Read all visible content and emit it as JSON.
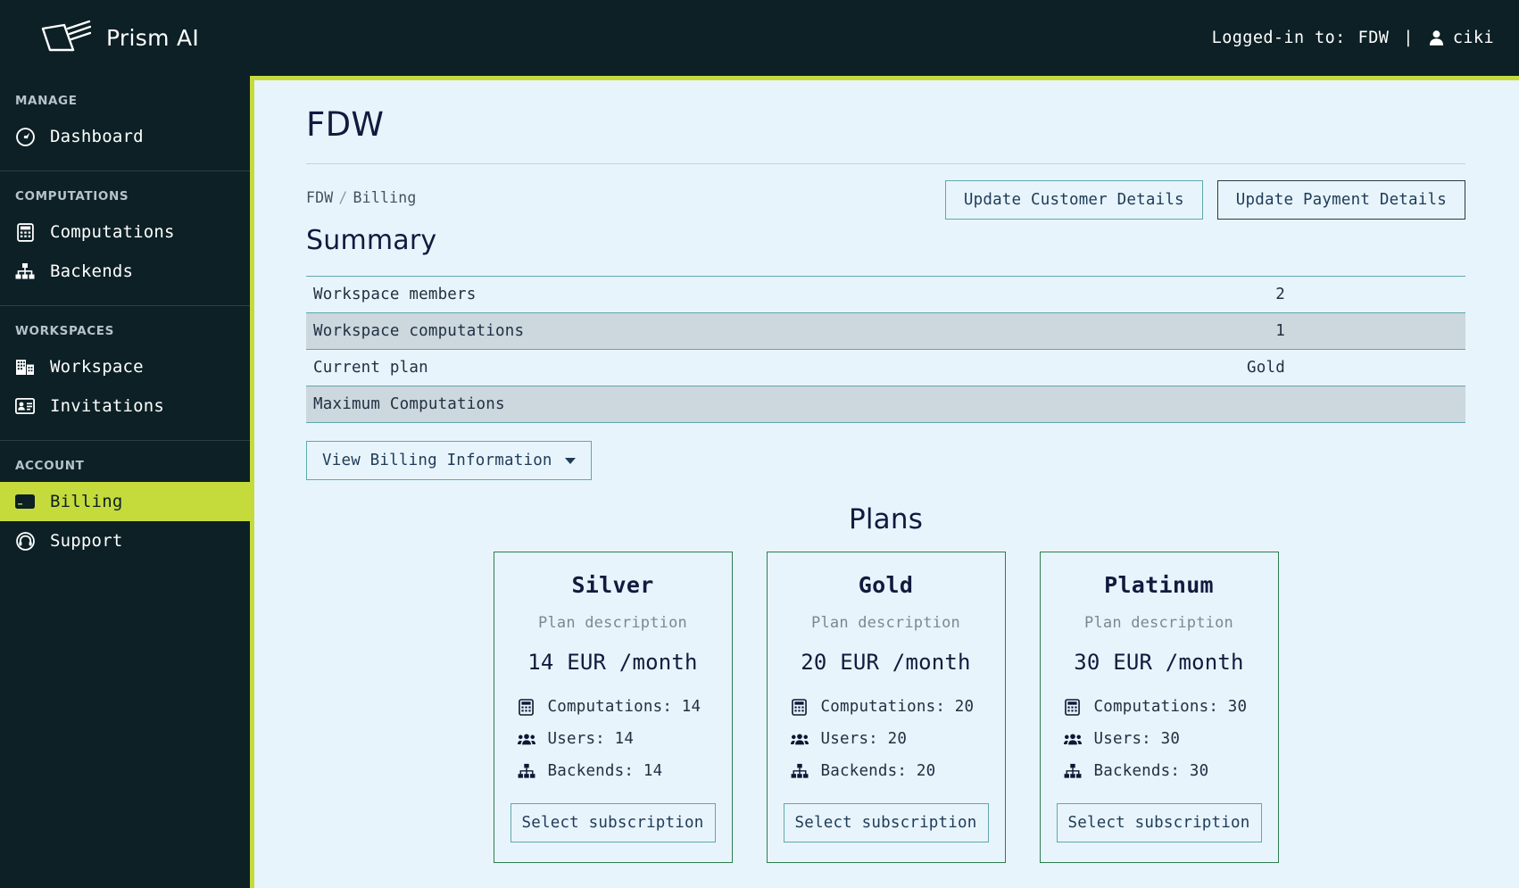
{
  "brand": {
    "name": "Prism AI",
    "logo_icon": "prism-logo-icon"
  },
  "topbar": {
    "logged_in_label": "Logged-in to:",
    "workspace": "FDW",
    "separator": "|",
    "user_icon": "user-icon",
    "username": "ciki"
  },
  "sidebar": {
    "groups": [
      {
        "title": "MANAGE",
        "items": [
          {
            "label": "Dashboard",
            "icon": "dashboard-gauge-icon",
            "active": false
          }
        ]
      },
      {
        "title": "COMPUTATIONS",
        "items": [
          {
            "label": "Computations",
            "icon": "calculator-icon",
            "active": false
          },
          {
            "label": "Backends",
            "icon": "sitemap-icon",
            "active": false
          }
        ]
      },
      {
        "title": "WORKSPACES",
        "items": [
          {
            "label": "Workspace",
            "icon": "building-icon",
            "active": false
          },
          {
            "label": "Invitations",
            "icon": "id-card-icon",
            "active": false
          }
        ]
      },
      {
        "title": "ACCOUNT",
        "items": [
          {
            "label": "Billing",
            "icon": "credit-card-icon",
            "active": true
          },
          {
            "label": "Support",
            "icon": "headset-icon",
            "active": false
          }
        ]
      }
    ]
  },
  "main": {
    "page_title": "FDW",
    "breadcrumb": {
      "root": "FDW",
      "separator": "/",
      "current": "Billing"
    },
    "actions": {
      "update_customer": "Update Customer Details",
      "update_payment": "Update Payment Details"
    },
    "summary": {
      "heading": "Summary",
      "rows": [
        {
          "label": "Workspace members",
          "value": "2"
        },
        {
          "label": "Workspace computations",
          "value": "1"
        },
        {
          "label": "Current plan",
          "value": "Gold"
        },
        {
          "label": "Maximum Computations",
          "value": ""
        }
      ],
      "billing_info_button": "View Billing Information",
      "billing_info_caret": "chevron-down-icon"
    },
    "plans": {
      "heading": "Plans",
      "cards": [
        {
          "name": "Silver",
          "description": "Plan description",
          "price": "14 EUR /month",
          "features": [
            {
              "icon": "calculator-icon",
              "text": "Computations: 14"
            },
            {
              "icon": "users-icon",
              "text": "Users: 14"
            },
            {
              "icon": "sitemap-icon",
              "text": "Backends: 14"
            }
          ],
          "button": "Select subscription"
        },
        {
          "name": "Gold",
          "description": "Plan description",
          "price": "20 EUR /month",
          "features": [
            {
              "icon": "calculator-icon",
              "text": "Computations: 20"
            },
            {
              "icon": "users-icon",
              "text": "Users: 20"
            },
            {
              "icon": "sitemap-icon",
              "text": "Backends: 20"
            }
          ],
          "button": "Select subscription"
        },
        {
          "name": "Platinum",
          "description": "Plan description",
          "price": "30 EUR /month",
          "features": [
            {
              "icon": "calculator-icon",
              "text": "Computations: 30"
            },
            {
              "icon": "users-icon",
              "text": "Users: 30"
            },
            {
              "icon": "sitemap-icon",
              "text": "Backends: 30"
            }
          ],
          "button": "Select subscription"
        }
      ]
    }
  },
  "colors": {
    "sidebar_bg": "#0c2025",
    "accent_lime": "#c5db3c",
    "main_bg": "#e8f4fc",
    "table_stripe": "#ccd7de",
    "border_teal": "#5fa8ae",
    "card_border_green": "#2e7d4f",
    "heading_navy": "#121a3e"
  }
}
